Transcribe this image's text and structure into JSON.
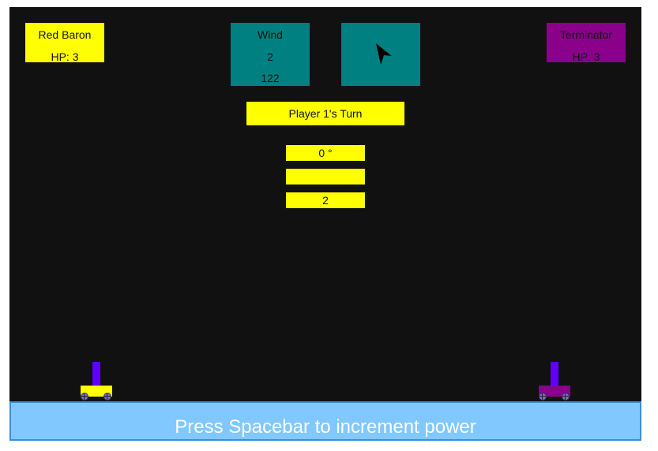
{
  "player1": {
    "name": "Red Baron",
    "hp": "HP: 3",
    "color": "#ffff00"
  },
  "player2": {
    "name": "Terminator",
    "hp": "HP: 3",
    "color": "#8b008b"
  },
  "wind": {
    "label": "Wind",
    "speed": "2",
    "direction": "122",
    "direction_icon": "cursor-arrow-icon"
  },
  "turn": "Player 1's Turn",
  "stats": {
    "angle": "0 °",
    "power": "",
    "value": "2"
  },
  "instruction": "Press Spacebar to increment power",
  "colors": {
    "background": "#111111",
    "panel_yellow": "#ffff00",
    "panel_teal": "#008080",
    "panel_purple": "#8b008b",
    "barrel": "#6000ff",
    "ground": "#80c8ff"
  }
}
